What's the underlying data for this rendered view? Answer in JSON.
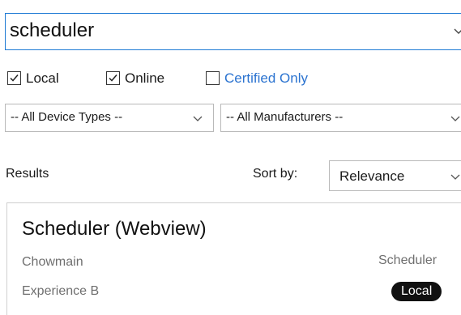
{
  "search": {
    "value": "scheduler"
  },
  "filters": {
    "local": {
      "label": "Local",
      "checked": true
    },
    "online": {
      "label": "Online",
      "checked": true
    },
    "certified": {
      "label": "Certified Only",
      "checked": false,
      "color": "#2b73d0"
    }
  },
  "device_types": {
    "selected": "-- All Device Types --"
  },
  "manufacturers": {
    "selected": "-- All Manufacturers --"
  },
  "results": {
    "label": "Results",
    "sort_label": "Sort by:",
    "sort_selected": "Relevance",
    "items": [
      {
        "title": "Scheduler (Webview)",
        "manufacturer": "Chowmain",
        "experience": "Experience B",
        "type": "Scheduler",
        "badge": "Local"
      }
    ]
  },
  "colors": {
    "accent_border": "#1e7ad4",
    "badge_bg": "#111111"
  }
}
